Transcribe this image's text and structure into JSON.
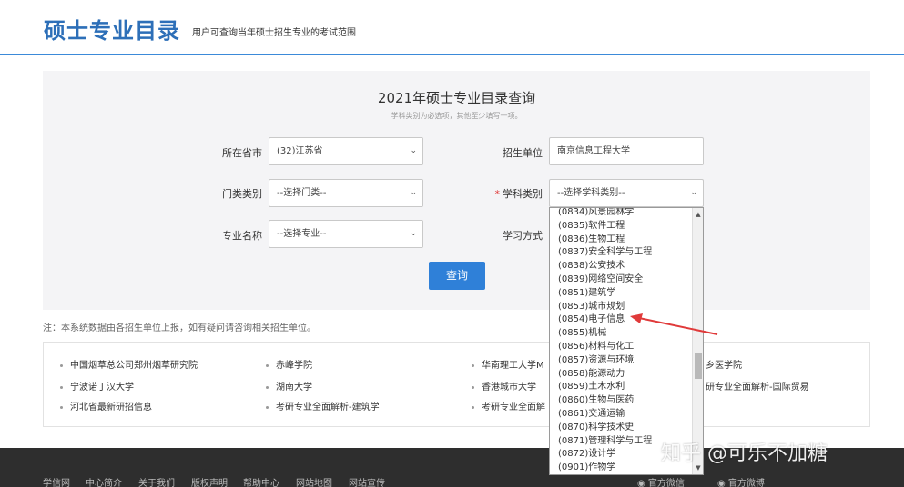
{
  "header": {
    "logo": "硕士专业目录",
    "subtitle": "用户可查询当年硕士招生专业的考试范围"
  },
  "query": {
    "title": "2021年硕士专业目录查询",
    "hint": "学科类别为必选项，其他至少填写一项。",
    "province_label": "所在省市",
    "province_value": "(32)江苏省",
    "unit_label": "招生单位",
    "unit_value": "南京信息工程大学",
    "category_label": "门类类别",
    "category_value": "--选择门类--",
    "required_mark": "*",
    "subject_label": "学科类别",
    "subject_value": "--选择学科类别--",
    "major_label": "专业名称",
    "major_value": "--选择专业--",
    "mode_label": "学习方式",
    "query_button": "查询"
  },
  "note": "注：本系统数据由各招生单位上报，如有疑问请咨询相关招生单位。",
  "links": [
    "中国烟草总公司郑州烟草研究院",
    "赤峰学院",
    "华南理工大学M",
    "乡医学院",
    "宁波诺丁汉大学",
    "湖南大学",
    "香港城市大学",
    "研专业全面解析-国际贸易",
    "河北省最新研招信息",
    "考研专业全面解析-建筑学",
    "考研专业全面解"
  ],
  "footer": {
    "links": [
      "学信网",
      "中心简介",
      "关于我们",
      "版权声明",
      "帮助中心",
      "网站地图",
      "网站宣传"
    ],
    "wechat": "官方微信",
    "weibo": "官方微博"
  },
  "dropdown": {
    "items": [
      "(0834)风景园林学",
      "(0835)软件工程",
      "(0836)生物工程",
      "(0837)安全科学与工程",
      "(0838)公安技术",
      "(0839)网络空间安全",
      "(0851)建筑学",
      "(0853)城市规划",
      "(0854)电子信息",
      "(0855)机械",
      "(0856)材料与化工",
      "(0857)资源与环境",
      "(0858)能源动力",
      "(0859)土木水利",
      "(0860)生物与医药",
      "(0861)交通运输",
      "(0870)科学技术史",
      "(0871)管理科学与工程",
      "(0872)设计学",
      "(0901)作物学"
    ]
  },
  "watermark": "知乎 @可乐不加糖",
  "colors": {
    "brand": "#2d6fb8",
    "button": "#2f80d8",
    "annotation": "#e03a3a",
    "footer": "#2e2e2e"
  }
}
